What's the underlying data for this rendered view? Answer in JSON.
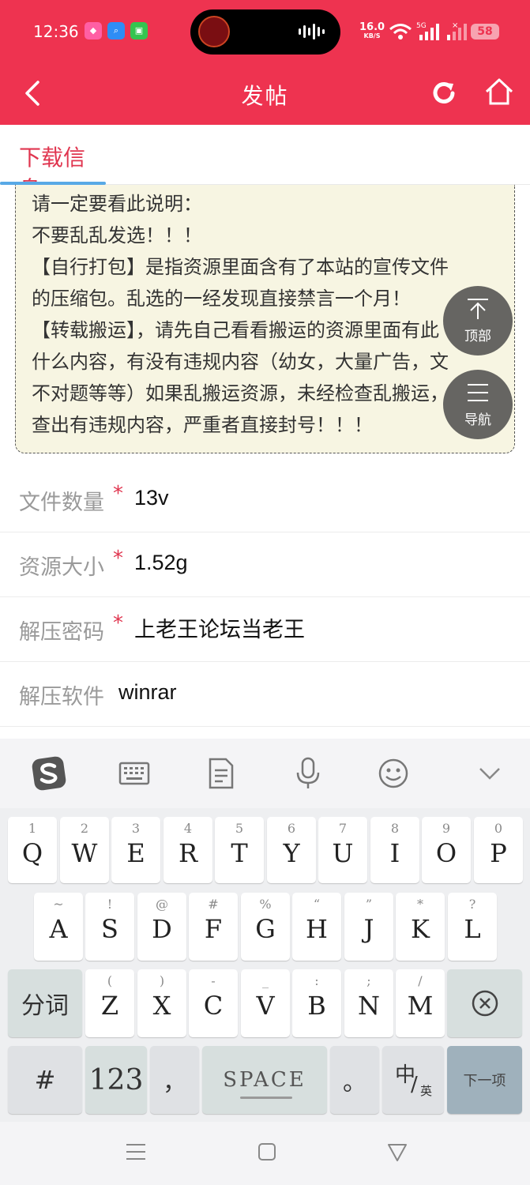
{
  "status_bar": {
    "time": "12:36",
    "net_speed": "16.0",
    "net_unit": "KB/S",
    "battery": "58"
  },
  "header": {
    "title": "发帖",
    "bg_color": "#ee3350"
  },
  "tabs": [
    {
      "label": "下载信息",
      "active": true
    }
  ],
  "notice": {
    "lines": [
      "请一定要看此说明：",
      "不要乱乱发选！！！",
      "【自行打包】是指资源里面含有了本站的宣传文件",
      "的压缩包。乱选的一经发现直接禁言一个月！",
      "【转载搬运】，请先自己看看搬运的资源里面有此",
      "什么内容，有没有违规内容（幼女，大量广告，文",
      "不对题等等）如果乱搬运资源，未经检查乱搬运，",
      "查出有违规内容，严重者直接封号！！！"
    ]
  },
  "float_buttons": {
    "top_label": "顶部",
    "nav_label": "导航"
  },
  "form": {
    "file_count": {
      "label": "文件数量",
      "required": "*",
      "value": "13v"
    },
    "size": {
      "label": "资源大小",
      "required": "*",
      "value": "1.52g"
    },
    "password": {
      "label": "解压密码",
      "required": "*",
      "value": "上老王论坛当老王"
    },
    "software": {
      "label": "解压软件",
      "value": "winrar"
    }
  },
  "keyboard": {
    "row1": [
      {
        "sub": "1",
        "main": "Q"
      },
      {
        "sub": "2",
        "main": "W"
      },
      {
        "sub": "3",
        "main": "E"
      },
      {
        "sub": "4",
        "main": "R"
      },
      {
        "sub": "5",
        "main": "T"
      },
      {
        "sub": "6",
        "main": "Y"
      },
      {
        "sub": "7",
        "main": "U"
      },
      {
        "sub": "8",
        "main": "I"
      },
      {
        "sub": "9",
        "main": "O"
      },
      {
        "sub": "0",
        "main": "P"
      }
    ],
    "row2": [
      {
        "sub": "~",
        "main": "A"
      },
      {
        "sub": "!",
        "main": "S"
      },
      {
        "sub": "@",
        "main": "D"
      },
      {
        "sub": "#",
        "main": "F"
      },
      {
        "sub": "%",
        "main": "G"
      },
      {
        "sub": "“",
        "main": "H"
      },
      {
        "sub": "”",
        "main": "J"
      },
      {
        "sub": "*",
        "main": "K"
      },
      {
        "sub": "?",
        "main": "L"
      }
    ],
    "row3": [
      {
        "sub": "(",
        "main": "Z"
      },
      {
        "sub": ")",
        "main": "X"
      },
      {
        "sub": "-",
        "main": "C"
      },
      {
        "sub": "_",
        "main": "V"
      },
      {
        "sub": ":",
        "main": "B"
      },
      {
        "sub": ";",
        "main": "N"
      },
      {
        "sub": "/",
        "main": "M"
      }
    ],
    "fenci": "分词",
    "hash": "#",
    "num": "123",
    "comma": "，",
    "space": "SPACE",
    "period": "。",
    "lang_zh": "中",
    "lang_slash": "/",
    "lang_en": "英",
    "next": "下一项"
  }
}
